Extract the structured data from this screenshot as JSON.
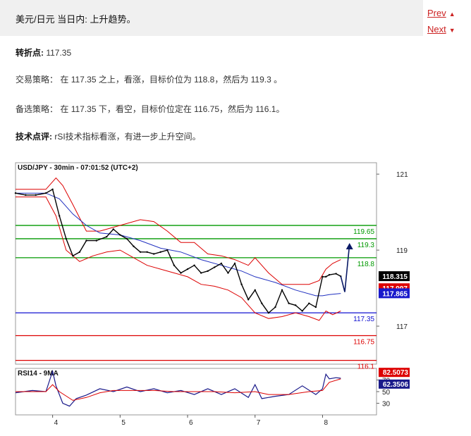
{
  "header": {
    "title": "美元/日元 当日内: 上升趋势。"
  },
  "nav": {
    "prev": "Prev",
    "next": "Next"
  },
  "pivot": {
    "label": "转折点:",
    "value": "117.35"
  },
  "strategy": {
    "label": "交易策略：",
    "text": "在 117.35 之上，看涨，目标价位为 118.8，然后为 119.3 。"
  },
  "alternative": {
    "label": "备选策略：",
    "text": "在 117.35 下，看空，目标价位定在 116.75，然后为 116.1。"
  },
  "comment": {
    "label": "技术点评:",
    "text": "rSI技术指标看涨，有进一步上升空间。"
  },
  "colors": {
    "support": "#1010d0",
    "resistance": "#009900",
    "target_down": "#dd0000",
    "price": "#000000",
    "ma": "#2030c0",
    "bands": "#dd0000"
  },
  "chart_data": {
    "type": "line",
    "title": "USD/JPY - 30min - 07:01:52 (UTC+2)",
    "price_axis": {
      "ylim": [
        116.0,
        121.3
      ],
      "ticks": [
        "121",
        "119",
        "117"
      ],
      "tick_values": [
        121,
        119,
        117
      ]
    },
    "x_ticks": [
      {
        "label": "4",
        "x": 4
      },
      {
        "label": "5",
        "x": 5
      },
      {
        "label": "6",
        "x": 6
      },
      {
        "label": "7",
        "x": 7
      },
      {
        "label": "8",
        "x": 8
      }
    ],
    "xlim": [
      3.45,
      8.8
    ],
    "levels": [
      {
        "label": "119.65",
        "value": 119.65,
        "kind": "resistance"
      },
      {
        "label": "119.3",
        "value": 119.3,
        "kind": "resistance"
      },
      {
        "label": "118.8",
        "value": 118.8,
        "kind": "resistance"
      },
      {
        "label": "117.35",
        "value": 117.35,
        "kind": "pivot"
      },
      {
        "label": "116.75",
        "value": 116.75,
        "kind": "target"
      },
      {
        "label": "116.1",
        "value": 116.1,
        "kind": "target"
      }
    ],
    "price_series": {
      "name": "Price",
      "x": [
        3.45,
        3.6,
        3.75,
        3.9,
        4.0,
        4.1,
        4.2,
        4.3,
        4.4,
        4.5,
        4.65,
        4.8,
        4.9,
        5.0,
        5.1,
        5.2,
        5.3,
        5.4,
        5.5,
        5.6,
        5.7,
        5.8,
        5.9,
        6.0,
        6.1,
        6.2,
        6.3,
        6.4,
        6.5,
        6.6,
        6.7,
        6.8,
        6.9,
        7.0,
        7.1,
        7.2,
        7.3,
        7.4,
        7.5,
        7.6,
        7.7,
        7.8,
        7.9,
        8.0,
        8.05,
        8.1,
        8.2,
        8.27
      ],
      "values": [
        120.5,
        120.45,
        120.45,
        120.5,
        120.6,
        119.9,
        119.3,
        118.85,
        118.95,
        119.25,
        119.25,
        119.35,
        119.55,
        119.4,
        119.3,
        119.1,
        118.95,
        118.95,
        118.9,
        118.95,
        119.0,
        118.6,
        118.4,
        118.5,
        118.6,
        118.4,
        118.45,
        118.55,
        118.65,
        118.4,
        118.65,
        118.1,
        117.7,
        117.95,
        117.6,
        117.35,
        117.5,
        117.95,
        117.6,
        117.55,
        117.4,
        117.6,
        117.5,
        118.3,
        118.3,
        118.35,
        118.38,
        118.31
      ]
    },
    "ma_series": {
      "name": "MA",
      "x": [
        3.45,
        3.9,
        4.1,
        4.3,
        4.5,
        4.7,
        5.0,
        5.3,
        5.6,
        5.9,
        6.2,
        6.5,
        6.8,
        7.0,
        7.3,
        7.6,
        7.9,
        8.0,
        8.1,
        8.27
      ],
      "values": [
        120.5,
        120.5,
        120.35,
        119.95,
        119.65,
        119.45,
        119.4,
        119.25,
        119.05,
        118.95,
        118.75,
        118.6,
        118.45,
        118.3,
        118.15,
        117.95,
        117.8,
        117.8,
        117.83,
        117.86
      ]
    },
    "bb_upper": {
      "x": [
        3.45,
        3.9,
        4.05,
        4.15,
        4.3,
        4.5,
        4.7,
        5.0,
        5.3,
        5.5,
        5.7,
        5.9,
        6.1,
        6.3,
        6.5,
        6.7,
        6.9,
        7.0,
        7.2,
        7.4,
        7.6,
        7.8,
        7.95,
        8.05,
        8.15,
        8.27
      ],
      "values": [
        120.6,
        120.6,
        120.9,
        120.7,
        120.2,
        119.5,
        119.5,
        119.65,
        119.8,
        119.75,
        119.5,
        119.2,
        119.2,
        118.9,
        118.85,
        118.75,
        118.6,
        118.8,
        118.4,
        118.1,
        118.1,
        118.1,
        118.2,
        118.5,
        118.65,
        118.75
      ]
    },
    "bb_lower": {
      "x": [
        3.45,
        3.9,
        4.05,
        4.2,
        4.4,
        4.6,
        4.8,
        5.0,
        5.2,
        5.4,
        5.6,
        5.8,
        6.0,
        6.2,
        6.4,
        6.6,
        6.8,
        7.0,
        7.2,
        7.4,
        7.6,
        7.8,
        7.95,
        8.05,
        8.15,
        8.27
      ],
      "values": [
        120.4,
        120.4,
        119.9,
        119.0,
        118.7,
        118.85,
        118.95,
        119.0,
        118.8,
        118.6,
        118.5,
        118.4,
        118.3,
        118.1,
        118.05,
        117.95,
        117.75,
        117.35,
        117.2,
        117.25,
        117.35,
        117.25,
        117.15,
        117.4,
        117.3,
        117.4
      ]
    },
    "projection": {
      "x": [
        8.27,
        8.33,
        8.4
      ],
      "values": [
        118.31,
        117.9,
        119.15
      ]
    },
    "price_tags": [
      {
        "label": "118.315",
        "value": 118.315,
        "color": "#000000"
      },
      {
        "label": "117.997",
        "value": 117.997,
        "color": "#dd0000"
      },
      {
        "label": "117.865",
        "value": 117.865,
        "color": "#1a1acc"
      }
    ],
    "rsi": {
      "title": "RSI14 - 9MA",
      "ylim": [
        10,
        90
      ],
      "ticks": [
        "70",
        "50",
        "30"
      ],
      "tick_values": [
        70,
        50,
        30
      ],
      "series": [
        {
          "name": "RSI14",
          "x": [
            3.45,
            3.7,
            3.9,
            4.0,
            4.05,
            4.15,
            4.25,
            4.35,
            4.5,
            4.7,
            4.9,
            5.1,
            5.3,
            5.5,
            5.7,
            5.9,
            6.1,
            6.3,
            6.5,
            6.7,
            6.9,
            7.0,
            7.1,
            7.3,
            7.5,
            7.7,
            7.9,
            8.0,
            8.05,
            8.1,
            8.2,
            8.27
          ],
          "values": [
            48,
            52,
            50,
            85,
            60,
            30,
            25,
            38,
            44,
            55,
            50,
            58,
            50,
            55,
            48,
            52,
            45,
            55,
            45,
            55,
            40,
            62,
            38,
            42,
            45,
            60,
            45,
            55,
            80,
            72,
            74,
            73
          ]
        },
        {
          "name": "9MA",
          "x": [
            3.45,
            3.9,
            4.0,
            4.1,
            4.3,
            4.5,
            4.7,
            4.9,
            5.2,
            5.5,
            5.8,
            6.1,
            6.4,
            6.7,
            7.0,
            7.2,
            7.5,
            7.8,
            8.0,
            8.1,
            8.27
          ],
          "values": [
            50,
            50,
            62,
            50,
            35,
            40,
            48,
            52,
            52,
            52,
            50,
            50,
            50,
            48,
            50,
            45,
            45,
            50,
            52,
            66,
            72
          ]
        }
      ],
      "tags": [
        {
          "label": "82.5073",
          "value": 82.5073,
          "color": "#dd0000"
        },
        {
          "label": "62.3506",
          "value": 62.3506,
          "color": "#1a1a8a"
        }
      ]
    }
  }
}
